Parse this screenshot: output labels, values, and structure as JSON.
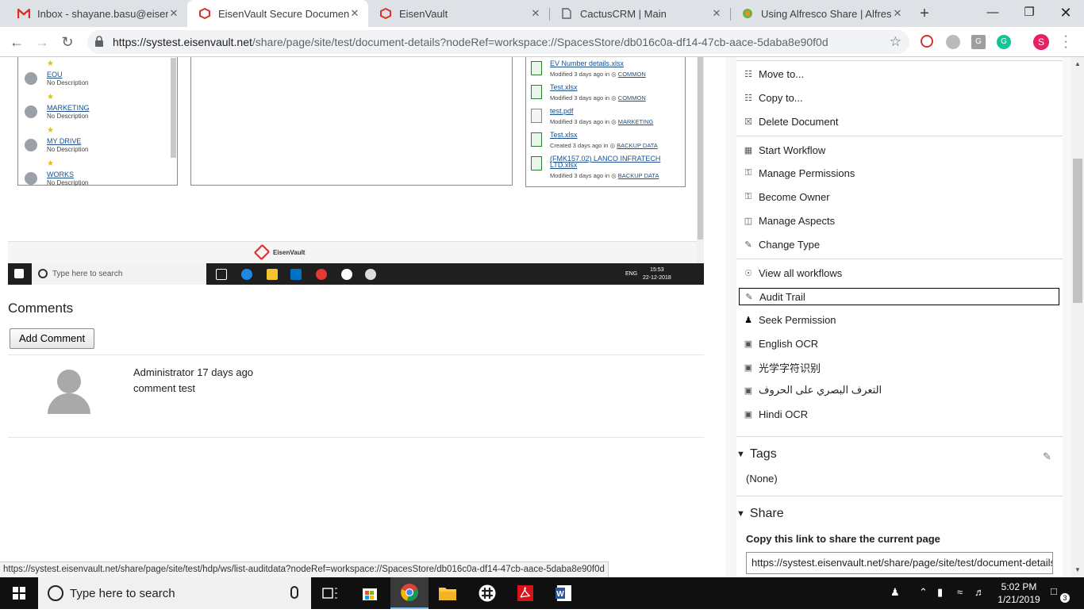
{
  "browser": {
    "tabs": [
      {
        "title": "Inbox - shayane.basu@eisenva",
        "favicon": "gmail-icon"
      },
      {
        "title": "EisenVault Secure Document S",
        "favicon": "eisenvault-icon",
        "active": true
      },
      {
        "title": "EisenVault",
        "favicon": "eisenvault-icon"
      },
      {
        "title": "CactusCRM | Main",
        "favicon": "page-icon"
      },
      {
        "title": "Using Alfresco Share | Alfresco",
        "favicon": "alfresco-icon"
      }
    ],
    "new_tab": "+",
    "close_glyph": "✕",
    "url_host": "https://systest.eisenvault.net",
    "url_path": "/share/page/site/test/document-details?nodeRef=workspace://SpacesStore/db016c0a-df14-47cb-aace-5daba8e90f0d",
    "profile_initial": "S"
  },
  "preview": {
    "sites": [
      {
        "name": "EOU",
        "desc": "No Description"
      },
      {
        "name": "MARKETING",
        "desc": "No Description"
      },
      {
        "name": "MY DRIVE",
        "desc": "No Description"
      },
      {
        "name": "WORKS",
        "desc": "No Description"
      }
    ],
    "documents": [
      {
        "name": "EV Number details.xlsx",
        "meta": "Modified 3 days ago in",
        "site": "COMMON",
        "type": "xlsx"
      },
      {
        "name": "Test.xlsx",
        "meta": "Modified 3 days ago in",
        "site": "COMMON",
        "type": "xlsx"
      },
      {
        "name": "test.pdf",
        "meta": "Modified 3 days ago in",
        "site": "MARKETING",
        "type": "pdf"
      },
      {
        "name": "Test.xlsx",
        "meta": "Created 3 days ago in",
        "site": "BACKUP DATA",
        "type": "xlsx"
      },
      {
        "name": "(FMK157.02) LANCO INFRATECH",
        "meta": "LTD.xlsx",
        "site": "",
        "type": "xlsx"
      },
      {
        "name": "",
        "meta": "Modified 3 days ago in",
        "site": "BACKUP DATA",
        "type": "none"
      }
    ],
    "footer_logo": "EisenVault",
    "taskbar_search": "Type here to search",
    "lang": "ENG",
    "time": "15:53",
    "date": "22-12-2018"
  },
  "comments": {
    "heading": "Comments",
    "add_button": "Add Comment",
    "items": [
      {
        "author_line": "Administrator 17 days ago",
        "text": "comment test"
      }
    ]
  },
  "actions": {
    "group1": [
      {
        "label": "Move to...",
        "icon": "move-icon"
      },
      {
        "label": "Copy to...",
        "icon": "copy-icon"
      },
      {
        "label": "Delete Document",
        "icon": "delete-icon"
      }
    ],
    "group2": [
      {
        "label": "Start Workflow",
        "icon": "workflow-icon"
      },
      {
        "label": "Manage Permissions",
        "icon": "key-icon"
      },
      {
        "label": "Become Owner",
        "icon": "key-icon"
      },
      {
        "label": "Manage Aspects",
        "icon": "aspects-icon"
      },
      {
        "label": "Change Type",
        "icon": "pencil-icon"
      }
    ],
    "group3": [
      {
        "label": "View all workflows",
        "icon": "workflows-icon"
      },
      {
        "label": "Audit Trail",
        "icon": "audit-icon"
      },
      {
        "label": "Seek Permission",
        "icon": "seek-permission-icon"
      },
      {
        "label": "English OCR",
        "icon": "ocr-icon"
      },
      {
        "label": "光学字符识别",
        "icon": "ocr-icon"
      },
      {
        "label": "التعرف البصري على الحروف",
        "icon": "ocr-icon"
      },
      {
        "label": "Hindi OCR",
        "icon": "ocr-icon"
      }
    ]
  },
  "tags": {
    "heading": "Tags",
    "value": "(None)"
  },
  "share": {
    "heading": "Share",
    "label": "Copy this link to share the current page",
    "link": "https://systest.eisenvault.net/share/page/site/test/document-details?nodeRef=workspace://SpacesStore/db016c0a-df14-47cb-aace-5daba8e90f0d"
  },
  "status_link": "https://systest.eisenvault.net/share/page/site/test/hdp/ws/list-auditdata?nodeRef=workspace://SpacesStore/db016c0a-df14-47cb-aace-5daba8e90f0d",
  "taskbar": {
    "search_placeholder": "Type here to search",
    "time": "5:02 PM",
    "date": "1/21/2019",
    "notifications": "3"
  },
  "colors": {
    "accent": "#d9322c",
    "link": "#1a4f8b",
    "taskbar": "#101010"
  }
}
